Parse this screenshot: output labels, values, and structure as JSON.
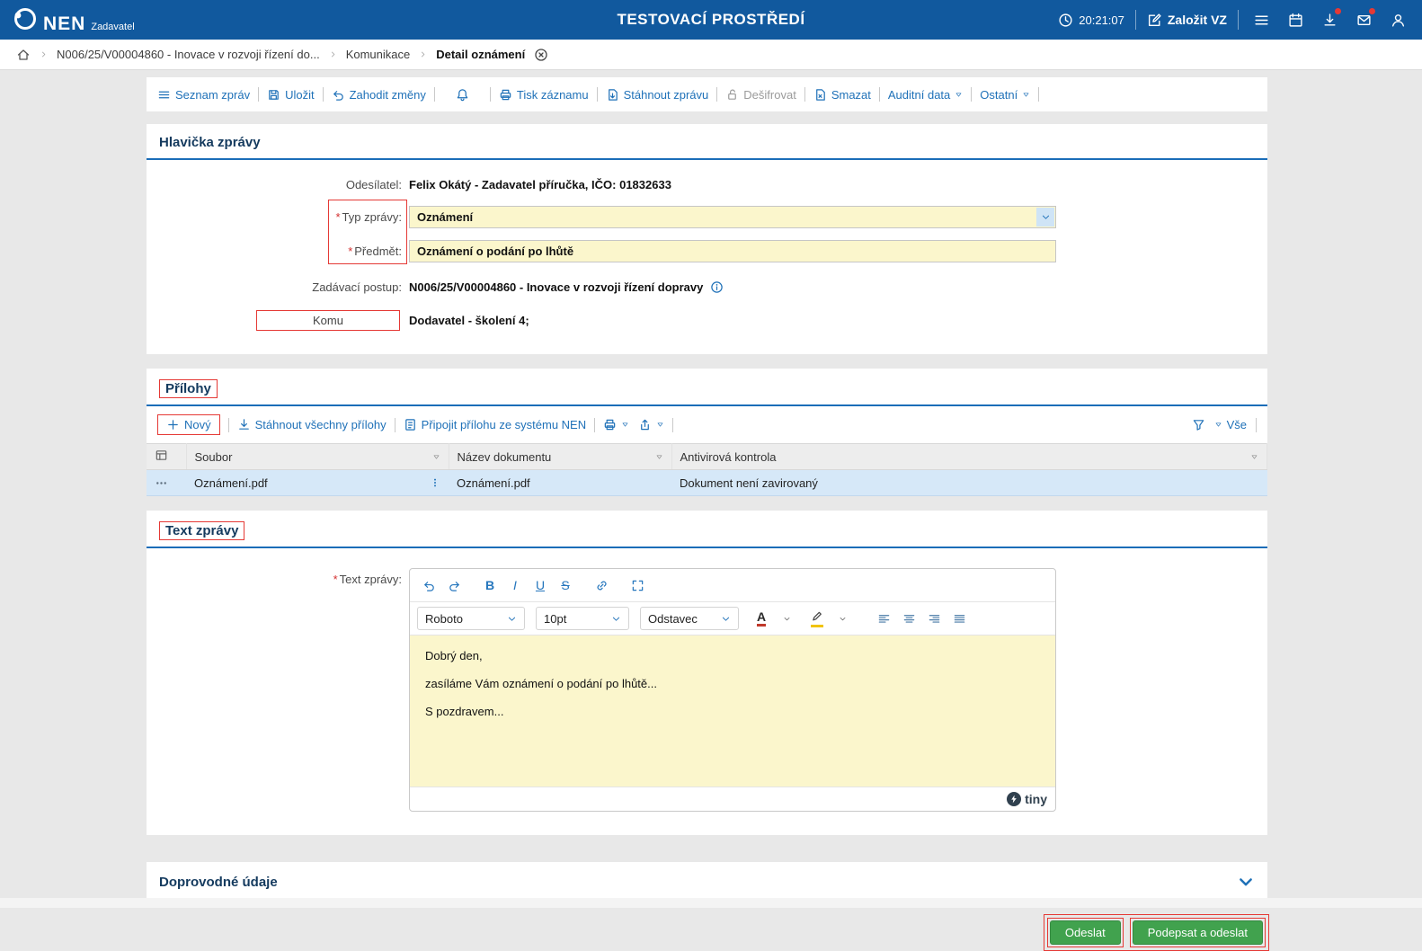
{
  "ui": {
    "required_marker": "*"
  },
  "colors": {
    "header_blue": "#11599e",
    "link_blue": "#1f71b8",
    "section_rule_blue": "#1b6db8",
    "field_yellow": "#fbf6cc",
    "selected_row_blue": "#d6e8f8",
    "green_button": "#41a24e",
    "red_annotation": "#e53935"
  },
  "header": {
    "brand": "NEN",
    "brand_subtitle": "Zadavatel",
    "environment_title": "TESTOVACÍ PROSTŘEDÍ",
    "time": "20:21:07",
    "create_vz_label": "Založit VZ"
  },
  "breadcrumb": {
    "items": [
      "N006/25/V00004860 - Inovace v rozvoji řízení do...",
      "Komunikace",
      "Detail oznámení"
    ]
  },
  "toolbar": {
    "seznam_zprav": "Seznam zpráv",
    "ulozit": "Uložit",
    "zahodit_zmeny": "Zahodit změny",
    "tisk_zaznamu": "Tisk záznamu",
    "stahnout_zpravu": "Stáhnout zprávu",
    "desifrovat": "Dešifrovat",
    "smazat": "Smazat",
    "auditni_data": "Auditní data",
    "ostatni": "Ostatní"
  },
  "message_header": {
    "section_title": "Hlavička zprávy",
    "odesilatel_label": "Odesílatel:",
    "odesilatel_value": "Felix Okátý - Zadavatel příručka, IČO: 01832633",
    "typ_zpravy_label": "Typ zprávy:",
    "typ_zpravy_value": "Oznámení",
    "predmet_label": "Předmět:",
    "predmet_value": "Oznámení o podání po lhůtě",
    "zadavaci_postup_label": "Zadávací postup:",
    "zadavaci_postup_value": "N006/25/V00004860 - Inovace v rozvoji řízení dopravy",
    "komu_label": "Komu",
    "komu_value": "Dodavatel - školení 4;"
  },
  "attachments": {
    "section_title": "Přílohy",
    "novy": "Nový",
    "stahnout_vsechny": "Stáhnout všechny přílohy",
    "pripojit": "Připojit přílohu ze systému NEN",
    "vse": "Vše",
    "columns": {
      "soubor": "Soubor",
      "nazev": "Název dokumentu",
      "antivir": "Antivirová kontrola"
    },
    "rows": [
      {
        "soubor": "Oznámení.pdf",
        "nazev": "Oznámení.pdf",
        "antivir": "Dokument není zavirovaný"
      }
    ]
  },
  "message_text": {
    "section_title": "Text zprávy",
    "label": "Text zprávy:",
    "editor": {
      "bold": "B",
      "italic": "I",
      "underline": "U",
      "strike": "S",
      "text_color": "A",
      "font_family": "Roboto",
      "font_size": "10pt",
      "block_format": "Odstavec",
      "paragraphs": [
        "Dobrý den,",
        "zasíláme Vám oznámení o podání po lhůtě...",
        "S pozdravem..."
      ],
      "brand": "tiny"
    }
  },
  "doprovodne": {
    "section_title": "Doprovodné údaje"
  },
  "actions": {
    "odeslat": "Odeslat",
    "podepsat_a_odeslat": "Podepsat a odeslat"
  }
}
